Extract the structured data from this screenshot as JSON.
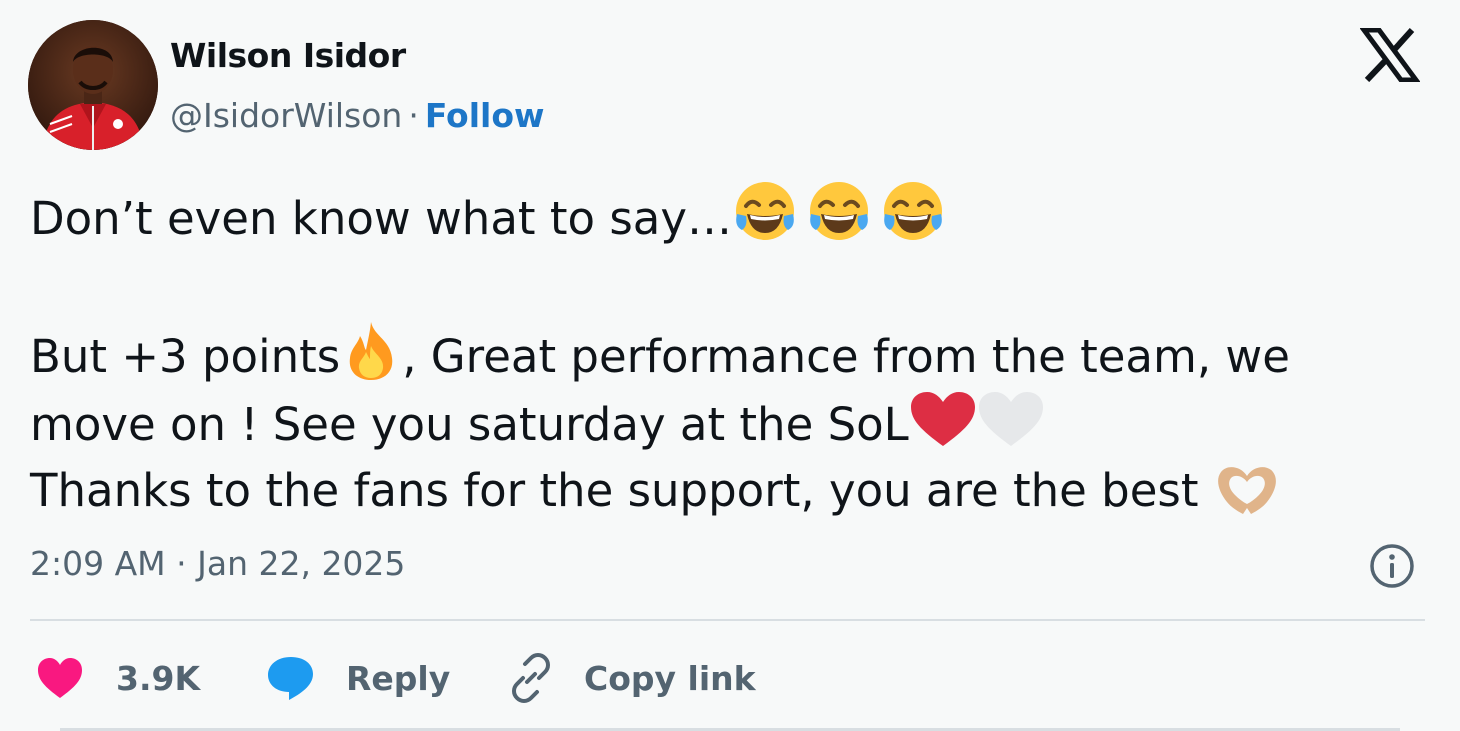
{
  "author": {
    "name": "Wilson Isidor",
    "handle": "@IsidorWilson",
    "separator": "·",
    "follow_label": "Follow"
  },
  "brand_icon": "x-logo-icon",
  "tweet": {
    "line1": "Don’t even know what to say…",
    "line1_emojis": [
      "face-with-tears-of-joy",
      "face-with-tears-of-joy",
      "face-with-tears-of-joy"
    ],
    "line2_a": "But +3 points",
    "line2_emoji": "fire",
    "line2_b": ", Great performance from the team, we",
    "line3": "move on ! See you saturday at the SoL",
    "line3_emojis": [
      "red-heart",
      "white-heart"
    ],
    "line4": "Thanks to the fans for the support, you are the best ",
    "line4_emoji": "heart-hands"
  },
  "timestamp": "2:09 AM · Jan 22, 2025",
  "actions": {
    "like_count": "3.9K",
    "reply_label": "Reply",
    "copy_label": "Copy link"
  },
  "colors": {
    "background": "#f7f9f9",
    "follow": "#1d76c7",
    "like": "#f91880",
    "reply": "#1d9bf0",
    "muted": "#536471"
  }
}
